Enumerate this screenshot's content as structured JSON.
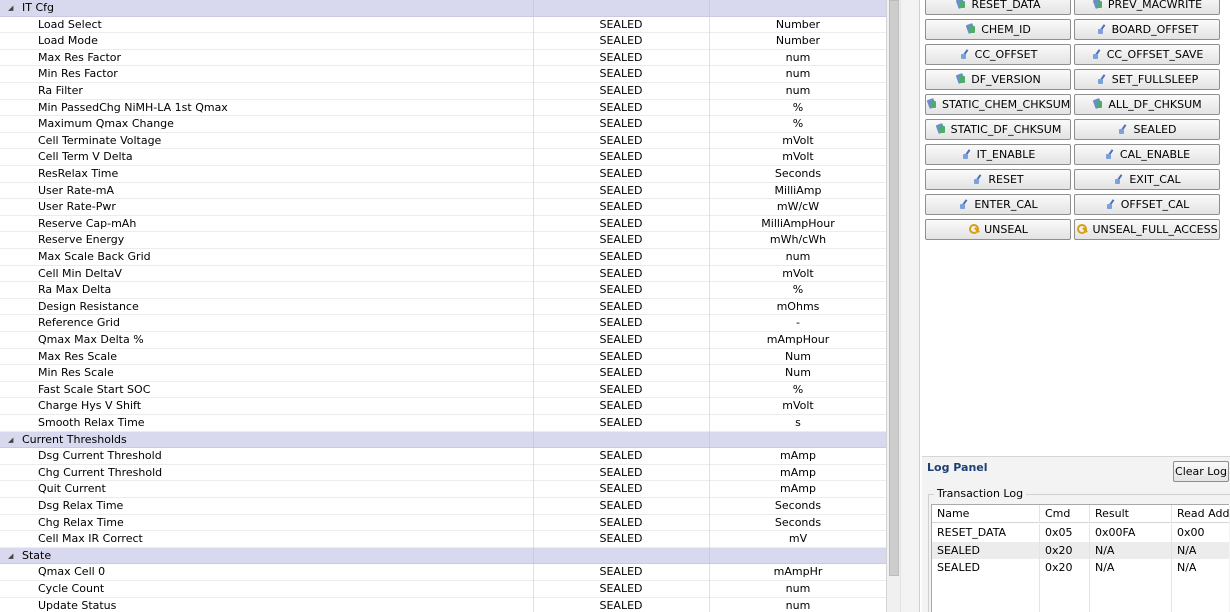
{
  "data_flash": {
    "rows": [
      {
        "kind": "group",
        "name": "IT Cfg"
      },
      {
        "kind": "item",
        "name": "Load Select",
        "access": "SEALED",
        "unit": "Number"
      },
      {
        "kind": "item",
        "name": "Load Mode",
        "access": "SEALED",
        "unit": "Number"
      },
      {
        "kind": "item",
        "name": "Max Res Factor",
        "access": "SEALED",
        "unit": "num"
      },
      {
        "kind": "item",
        "name": "Min Res Factor",
        "access": "SEALED",
        "unit": "num"
      },
      {
        "kind": "item",
        "name": "Ra Filter",
        "access": "SEALED",
        "unit": "num"
      },
      {
        "kind": "item",
        "name": "Min PassedChg NiMH-LA 1st Qmax",
        "access": "SEALED",
        "unit": "%"
      },
      {
        "kind": "item",
        "name": "Maximum Qmax Change",
        "access": "SEALED",
        "unit": "%"
      },
      {
        "kind": "item",
        "name": "Cell Terminate Voltage",
        "access": "SEALED",
        "unit": "mVolt"
      },
      {
        "kind": "item",
        "name": "Cell Term V Delta",
        "access": "SEALED",
        "unit": "mVolt"
      },
      {
        "kind": "item",
        "name": "ResRelax Time",
        "access": "SEALED",
        "unit": "Seconds"
      },
      {
        "kind": "item",
        "name": "User Rate-mA",
        "access": "SEALED",
        "unit": "MilliAmp"
      },
      {
        "kind": "item",
        "name": "User Rate-Pwr",
        "access": "SEALED",
        "unit": "mW/cW"
      },
      {
        "kind": "item",
        "name": "Reserve Cap-mAh",
        "access": "SEALED",
        "unit": "MilliAmpHour"
      },
      {
        "kind": "item",
        "name": "Reserve Energy",
        "access": "SEALED",
        "unit": "mWh/cWh"
      },
      {
        "kind": "item",
        "name": "Max Scale Back Grid",
        "access": "SEALED",
        "unit": "num"
      },
      {
        "kind": "item",
        "name": "Cell Min DeltaV",
        "access": "SEALED",
        "unit": "mVolt"
      },
      {
        "kind": "item",
        "name": "Ra Max Delta",
        "access": "SEALED",
        "unit": "%"
      },
      {
        "kind": "item",
        "name": "Design Resistance",
        "access": "SEALED",
        "unit": "mOhms"
      },
      {
        "kind": "item",
        "name": "Reference Grid",
        "access": "SEALED",
        "unit": "-"
      },
      {
        "kind": "item",
        "name": "Qmax Max Delta %",
        "access": "SEALED",
        "unit": "mAmpHour"
      },
      {
        "kind": "item",
        "name": "Max Res Scale",
        "access": "SEALED",
        "unit": "Num"
      },
      {
        "kind": "item",
        "name": "Min Res Scale",
        "access": "SEALED",
        "unit": "Num"
      },
      {
        "kind": "item",
        "name": "Fast Scale Start SOC",
        "access": "SEALED",
        "unit": "%"
      },
      {
        "kind": "item",
        "name": "Charge Hys V Shift",
        "access": "SEALED",
        "unit": "mVolt"
      },
      {
        "kind": "item",
        "name": "Smooth Relax Time",
        "access": "SEALED",
        "unit": "s"
      },
      {
        "kind": "group",
        "name": "Current Thresholds"
      },
      {
        "kind": "item",
        "name": "Dsg Current Threshold",
        "access": "SEALED",
        "unit": "mAmp"
      },
      {
        "kind": "item",
        "name": "Chg Current Threshold",
        "access": "SEALED",
        "unit": "mAmp"
      },
      {
        "kind": "item",
        "name": "Quit Current",
        "access": "SEALED",
        "unit": "mAmp"
      },
      {
        "kind": "item",
        "name": "Dsg Relax Time",
        "access": "SEALED",
        "unit": "Seconds"
      },
      {
        "kind": "item",
        "name": "Chg Relax Time",
        "access": "SEALED",
        "unit": "Seconds"
      },
      {
        "kind": "item",
        "name": "Cell Max IR Correct",
        "access": "SEALED",
        "unit": "mV"
      },
      {
        "kind": "group",
        "name": "State"
      },
      {
        "kind": "item",
        "name": "Qmax Cell 0",
        "access": "SEALED",
        "unit": "mAmpHr"
      },
      {
        "kind": "item",
        "name": "Cycle Count",
        "access": "SEALED",
        "unit": "num"
      },
      {
        "kind": "item",
        "name": "Update Status",
        "access": "SEALED",
        "unit": "num"
      }
    ]
  },
  "commands": {
    "rows": [
      [
        {
          "label": "RESET_DATA",
          "icon": "stack-icon"
        },
        {
          "label": "PREV_MACWRITE",
          "icon": "stack-icon"
        }
      ],
      [
        {
          "label": "CHEM_ID",
          "icon": "stack-icon"
        },
        {
          "label": "BOARD_OFFSET",
          "icon": "send-icon"
        }
      ],
      [
        {
          "label": "CC_OFFSET",
          "icon": "send-icon"
        },
        {
          "label": "CC_OFFSET_SAVE",
          "icon": "send-icon"
        }
      ],
      [
        {
          "label": "DF_VERSION",
          "icon": "stack-icon"
        },
        {
          "label": "SET_FULLSLEEP",
          "icon": "send-icon"
        }
      ],
      [
        {
          "label": "STATIC_CHEM_CHKSUM",
          "icon": "stack-icon"
        },
        {
          "label": "ALL_DF_CHKSUM",
          "icon": "stack-icon"
        }
      ],
      [
        {
          "label": "STATIC_DF_CHKSUM",
          "icon": "stack-icon"
        },
        {
          "label": "SEALED",
          "icon": "send-icon"
        }
      ],
      [
        {
          "label": "IT_ENABLE",
          "icon": "send-icon"
        },
        {
          "label": "CAL_ENABLE",
          "icon": "send-icon"
        }
      ],
      [
        {
          "label": "RESET",
          "icon": "send-icon"
        },
        {
          "label": "EXIT_CAL",
          "icon": "send-icon"
        }
      ],
      [
        {
          "label": "ENTER_CAL",
          "icon": "send-icon"
        },
        {
          "label": "OFFSET_CAL",
          "icon": "send-icon"
        }
      ],
      [
        {
          "label": "UNSEAL",
          "icon": "key-icon"
        },
        {
          "label": "UNSEAL_FULL_ACCESS",
          "icon": "key-icon"
        }
      ]
    ]
  },
  "log": {
    "title": "Log Panel",
    "clear_label": "Clear Log",
    "transaction_label": "Transaction Log",
    "columns": [
      "Name",
      "Cmd",
      "Result",
      "Read Addr"
    ],
    "rows": [
      [
        "RESET_DATA",
        "0x05",
        "0x00FA",
        "0x00"
      ],
      [
        "SEALED",
        "0x20",
        "N/A",
        "N/A"
      ],
      [
        "SEALED",
        "0x20",
        "N/A",
        "N/A"
      ]
    ]
  },
  "colors": {
    "group_row": "#d8d8ee",
    "log_title": "#1d3f73",
    "send_icon": "#4a6fb8",
    "key_icon": "#d4a017"
  }
}
